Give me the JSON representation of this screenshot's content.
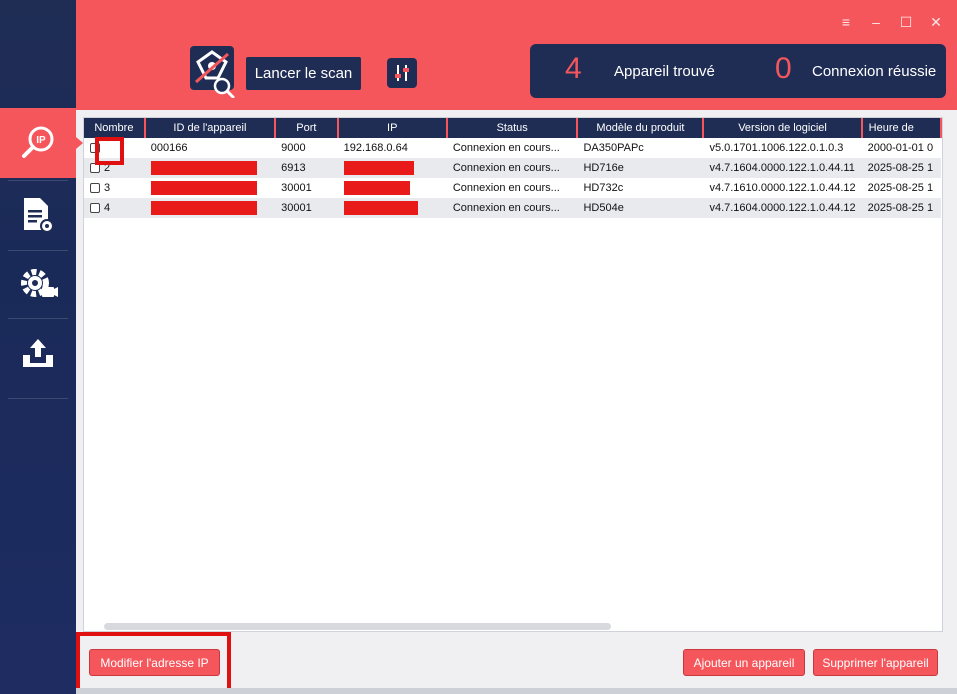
{
  "window": {
    "controls": [
      "≡",
      "–",
      "☐",
      "✕"
    ]
  },
  "header": {
    "scan_label": "Lancer le scan",
    "found_count": "4",
    "found_label": "Appareil trouvé",
    "connected_count": "0",
    "connected_label": "Connexion réussie"
  },
  "sidebar": {
    "items": [
      {
        "icon": "ip-search-icon",
        "active": true
      },
      {
        "icon": "document-settings-icon"
      },
      {
        "icon": "camera-settings-icon"
      },
      {
        "icon": "upload-icon"
      }
    ]
  },
  "table": {
    "columns": [
      "Nombre",
      "ID de l'appareil",
      "Port",
      "IP",
      "Status",
      "Modèle du produit",
      "Version de logiciel",
      "Heure de"
    ],
    "rows": [
      {
        "num": "",
        "id": "000166",
        "port": "9000",
        "ip": "192.168.0.64",
        "status": "Connexion en cours...",
        "model": "DA350PAPc",
        "version": "v5.0.1701.1006.122.0.1.0.3",
        "time": "2000-01-01 0"
      },
      {
        "num": "2",
        "id": "",
        "port": "6913",
        "ip": "",
        "status": "Connexion en cours...",
        "model": "HD716e",
        "version": "v4.7.1604.0000.122.1.0.44.11",
        "time": "2025-08-25 1"
      },
      {
        "num": "3",
        "id": "",
        "port": "30001",
        "ip": "",
        "status": "Connexion en cours...",
        "model": "HD732c",
        "version": "v4.7.1610.0000.122.1.0.44.12",
        "time": "2025-08-25 1"
      },
      {
        "num": "4",
        "id": "",
        "port": "30001",
        "ip": "",
        "status": "Connexion en cours...",
        "model": "HD504e",
        "version": "v4.7.1604.0000.122.1.0.44.12",
        "time": "2025-08-25 1"
      }
    ]
  },
  "footer": {
    "modify_ip_label": "Modifier l'adresse IP",
    "add_device_label": "Ajouter un appareil",
    "delete_device_label": "Supprimer l'appareil"
  },
  "colors": {
    "accent": "#f5565c",
    "navy": "#1f2d55",
    "highlight": "#e11010"
  }
}
